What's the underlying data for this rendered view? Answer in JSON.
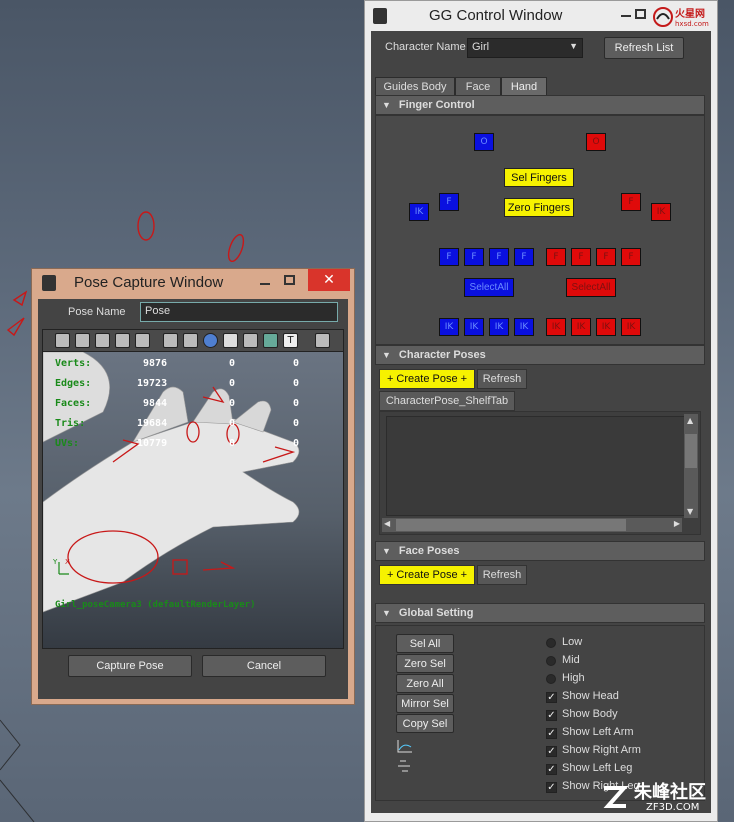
{
  "gg_window": {
    "title": "GG Control Window",
    "character_label": "Character Name",
    "character_value": "Girl",
    "refresh_label": "Refresh List",
    "tabs": [
      "Guides Body",
      "Face",
      "Hand"
    ],
    "active_tab": "Hand",
    "finger_control": {
      "header": "Finger Control",
      "sel_fingers": "Sel Fingers",
      "zero_fingers": "Zero Fingers",
      "select_all_left": "SelectAll",
      "select_all_right": "SelectAll",
      "o_label": "O",
      "f_label": "F",
      "ik_label": "IK",
      "blue_color": "#0a10e0",
      "red_color": "#e00a0a",
      "yellow_color": "#f6f200"
    },
    "character_poses": {
      "header": "Character Poses",
      "create_label": "+ Create Pose +",
      "refresh_label": "Refresh",
      "shelf_tab": "CharacterPose_ShelfTab"
    },
    "face_poses": {
      "header": "Face Poses",
      "create_label": "+ Create Pose +",
      "refresh_label": "Refresh"
    },
    "global_setting": {
      "header": "Global Setting",
      "buttons": [
        "Sel All",
        "Zero Sel",
        "Zero All",
        "Mirror Sel",
        "Copy Sel"
      ],
      "radios": [
        "Low",
        "Mid",
        "High"
      ],
      "checks": [
        "Show Head",
        "Show Body",
        "Show Left Arm",
        "Show Right Arm",
        "Show Left Leg",
        "Show Right Leg"
      ]
    },
    "watermark": "火星网\nhxsd.com"
  },
  "pose_window": {
    "title": "Pose Capture Window",
    "pose_name_label": "Pose Name",
    "pose_name_value": "Pose",
    "capture_label": "Capture Pose",
    "cancel_label": "Cancel",
    "hud": [
      {
        "key": "Verts:",
        "v1": "9876",
        "v2": "0",
        "v3": "0"
      },
      {
        "key": "Edges:",
        "v1": "19723",
        "v2": "0",
        "v3": "0"
      },
      {
        "key": "Faces:",
        "v1": "9844",
        "v2": "0",
        "v3": "0"
      },
      {
        "key": "Tris:",
        "v1": "19684",
        "v2": "0",
        "v3": "0"
      },
      {
        "key": "UVs:",
        "v1": "10779",
        "v2": "0",
        "v3": "0"
      }
    ],
    "camera_label": "Girl_poseCamera3 (defaultRenderLayer)"
  },
  "watermark_bottom": {
    "cn": "朱峰社区",
    "en": "ZF3D.COM"
  }
}
